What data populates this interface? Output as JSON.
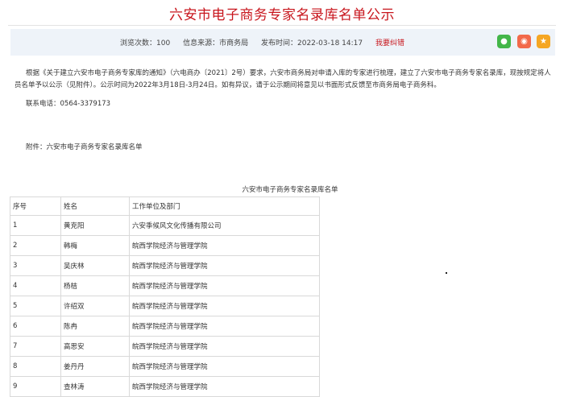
{
  "page": {
    "title": "六安市电子商务专家名录库名单公示"
  },
  "meta": {
    "views_label": "浏览次数：",
    "views": "100",
    "source_label": "信息来源：",
    "source": "市商务局",
    "time_label": "发布时间：",
    "time": "2022-03-18 14:17",
    "correction": "我要纠错"
  },
  "share": {
    "wechat_icon": "wechat-icon",
    "weibo_icon": "weibo-icon",
    "favorite_icon": "star-icon",
    "wechat_color": "#43b649",
    "weibo_color": "#f2694a",
    "favorite_color": "#f5a623"
  },
  "article": {
    "paragraph": "根据《关于建立六安市电子商务专家库的通知》（六电商办〔2021〕2号）要求，六安市商务局对申请入库的专家进行梳理，建立了六安市电子商务专家名录库，现按规定将人员名单予以公示（见附件）。公示时间为2022年3月18日-3月24日。如有异议，请于公示期间将意见以书面形式反馈至市商务局电子商务科。",
    "phone": "联系电话：0564-3379173",
    "attachment": "附件：六安市电子商务专家名录库名单"
  },
  "table": {
    "caption": "六安市电子商务专家名录库名单",
    "headers": [
      "序号",
      "姓名",
      "工作单位及部门"
    ],
    "rows": [
      [
        "1",
        "黄克阳",
        "六安季候风文化传播有限公司"
      ],
      [
        "2",
        "韩梅",
        "皖西学院经济与管理学院"
      ],
      [
        "3",
        "吴庆林",
        "皖西学院经济与管理学院"
      ],
      [
        "4",
        "杨桔",
        "皖西学院经济与管理学院"
      ],
      [
        "5",
        "许绍双",
        "皖西学院经济与管理学院"
      ],
      [
        "6",
        "陈冉",
        "皖西学院经济与管理学院"
      ],
      [
        "7",
        "高思安",
        "皖西学院经济与管理学院"
      ],
      [
        "8",
        "姜丹丹",
        "皖西学院经济与管理学院"
      ],
      [
        "9",
        "查林涛",
        "皖西学院经济与管理学院"
      ]
    ]
  },
  "colors": {
    "title": "#c8161d",
    "meta_bar": "#eef3f9",
    "border": "#d9d9d9"
  }
}
